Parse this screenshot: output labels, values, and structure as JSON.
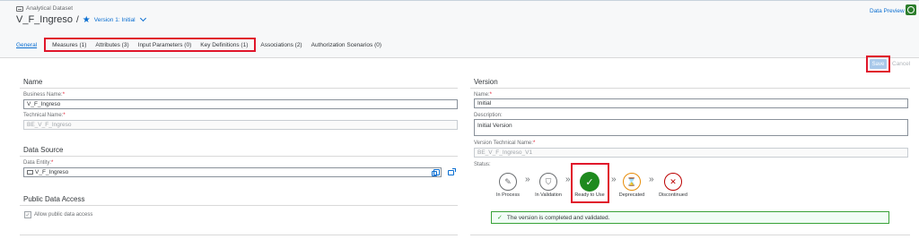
{
  "header": {
    "breadcrumb": "Analytical Dataset",
    "title": "V_F_Ingreso",
    "separator": "/",
    "version_label": "Version 1: Initial",
    "data_preview": "Data Preview"
  },
  "tabs": [
    {
      "label": "General"
    },
    {
      "label": "Measures (1)"
    },
    {
      "label": "Attributes (3)"
    },
    {
      "label": "Input Parameters (0)"
    },
    {
      "label": "Key Definitions (1)"
    },
    {
      "label": "Associations (2)"
    },
    {
      "label": "Authorization Scenarios (0)"
    }
  ],
  "toolbar": {
    "save_label": "Save",
    "cancel_label": "Cancel"
  },
  "name_section": {
    "title": "Name",
    "business_name_label": "Business Name:",
    "business_name_value": "V_F_Ingreso",
    "technical_name_label": "Technical Name:",
    "technical_name_value": "BE_V_F_Ingreso"
  },
  "data_source": {
    "title": "Data Source",
    "entity_label": "Data Entity:",
    "entity_value": "V_F_Ingreso"
  },
  "public_access": {
    "title": "Public Data Access",
    "checkbox_label": "Allow public data access",
    "checked": true
  },
  "version": {
    "title": "Version",
    "name_label": "Name:",
    "name_value": "Initial",
    "description_label": "Description:",
    "description_value": "Initial Version",
    "tech_name_label": "Version Technical Name:",
    "tech_name_value": "BE_V_F_Ingreso_V1",
    "status_label": "Status:",
    "statuses": [
      {
        "label": "In Process"
      },
      {
        "label": "In Validation"
      },
      {
        "label": "Ready to Use"
      },
      {
        "label": "Deprecated"
      },
      {
        "label": "Discontinued"
      }
    ],
    "message": "The version is completed and validated."
  },
  "required_marker": "*",
  "colors": {
    "accent": "#0a6ed1",
    "success": "#1e8a1e",
    "highlight": "#e0162b",
    "warning": "#e78c07",
    "error": "#bb0000"
  }
}
